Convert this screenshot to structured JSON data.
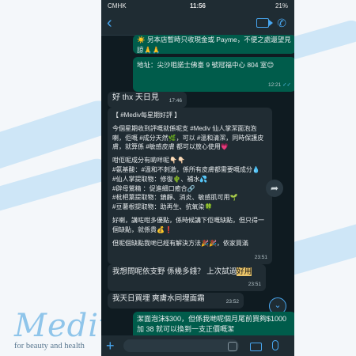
{
  "status_bar": {
    "carrier": "CMHK",
    "time": "11:56",
    "battery": "21%"
  },
  "messages": {
    "m1": {
      "text": "☀️ 另本店暫時只收現金或 Payme，不便之處還望見諒🙏🙏"
    },
    "m2": {
      "text": "地址：尖沙咀諾士佛臺 9 號冠福中心 804 室😊",
      "time": "12:21"
    },
    "m3": {
      "text": "好 thx 天日見",
      "time": "17:46"
    },
    "m4": {
      "lines": [
        "【 #Mediv每星期好評 】",
        "",
        "今個星期收到評嘅就係呢支 #Mediv 仙人掌潔面泡泡喇，佢嘅 #成分天然🌿，可以 #溫和清潔，同時保護皮膚，就算係 #敏感皮膚 都可以放心使用💗",
        "",
        "咁佢呢成分有啲咩呢👇🏻👇🏻",
        "#氨基酸：#溫和不刺激，係所有皮膚都需要嘅成分💧",
        "#仙人掌提取物：修復🌵、補水💦",
        "#辟母鶯精 ：促進細口癒合🔗",
        "#枇杷葉提取物：鎮靜、消炎、敏感肌可用🌱",
        "#豆薯根提取物：助再生、抗氧染🍀",
        "",
        "好喇，講咗咁多優點，係時候講下佢嘅缺點，但只得一個缺點，就係貴💰❗",
        "",
        "但呢個缺點我哋已經有解決方法🎉🎉，依家買滿"
      ],
      "time": "23:51"
    },
    "m5": {
      "text_before": "我想問呢依支野 係幾多錢？ 上次試過",
      "highlight": "好用",
      "time": "23:51"
    },
    "m6": {
      "text": "我天日買埋 爽膚水同埋面霜",
      "time": "23:52"
    },
    "m7": {
      "text": "潔面泡沫$300，但係我哋呢個月尾前買夠$1000 加 38 就可以換到一支正價嘅潔"
    }
  },
  "brand": {
    "logo": "Mediv",
    "tagline": "for beauty and health"
  },
  "icons": {
    "back": "back-arrow-icon",
    "video": "video-call-icon",
    "call": "phone-call-icon",
    "share": "share-icon",
    "scroll": "scroll-down-icon",
    "plus": "plus-icon",
    "camera": "camera-icon",
    "mic": "microphone-icon",
    "sticker": "sticker-icon"
  }
}
